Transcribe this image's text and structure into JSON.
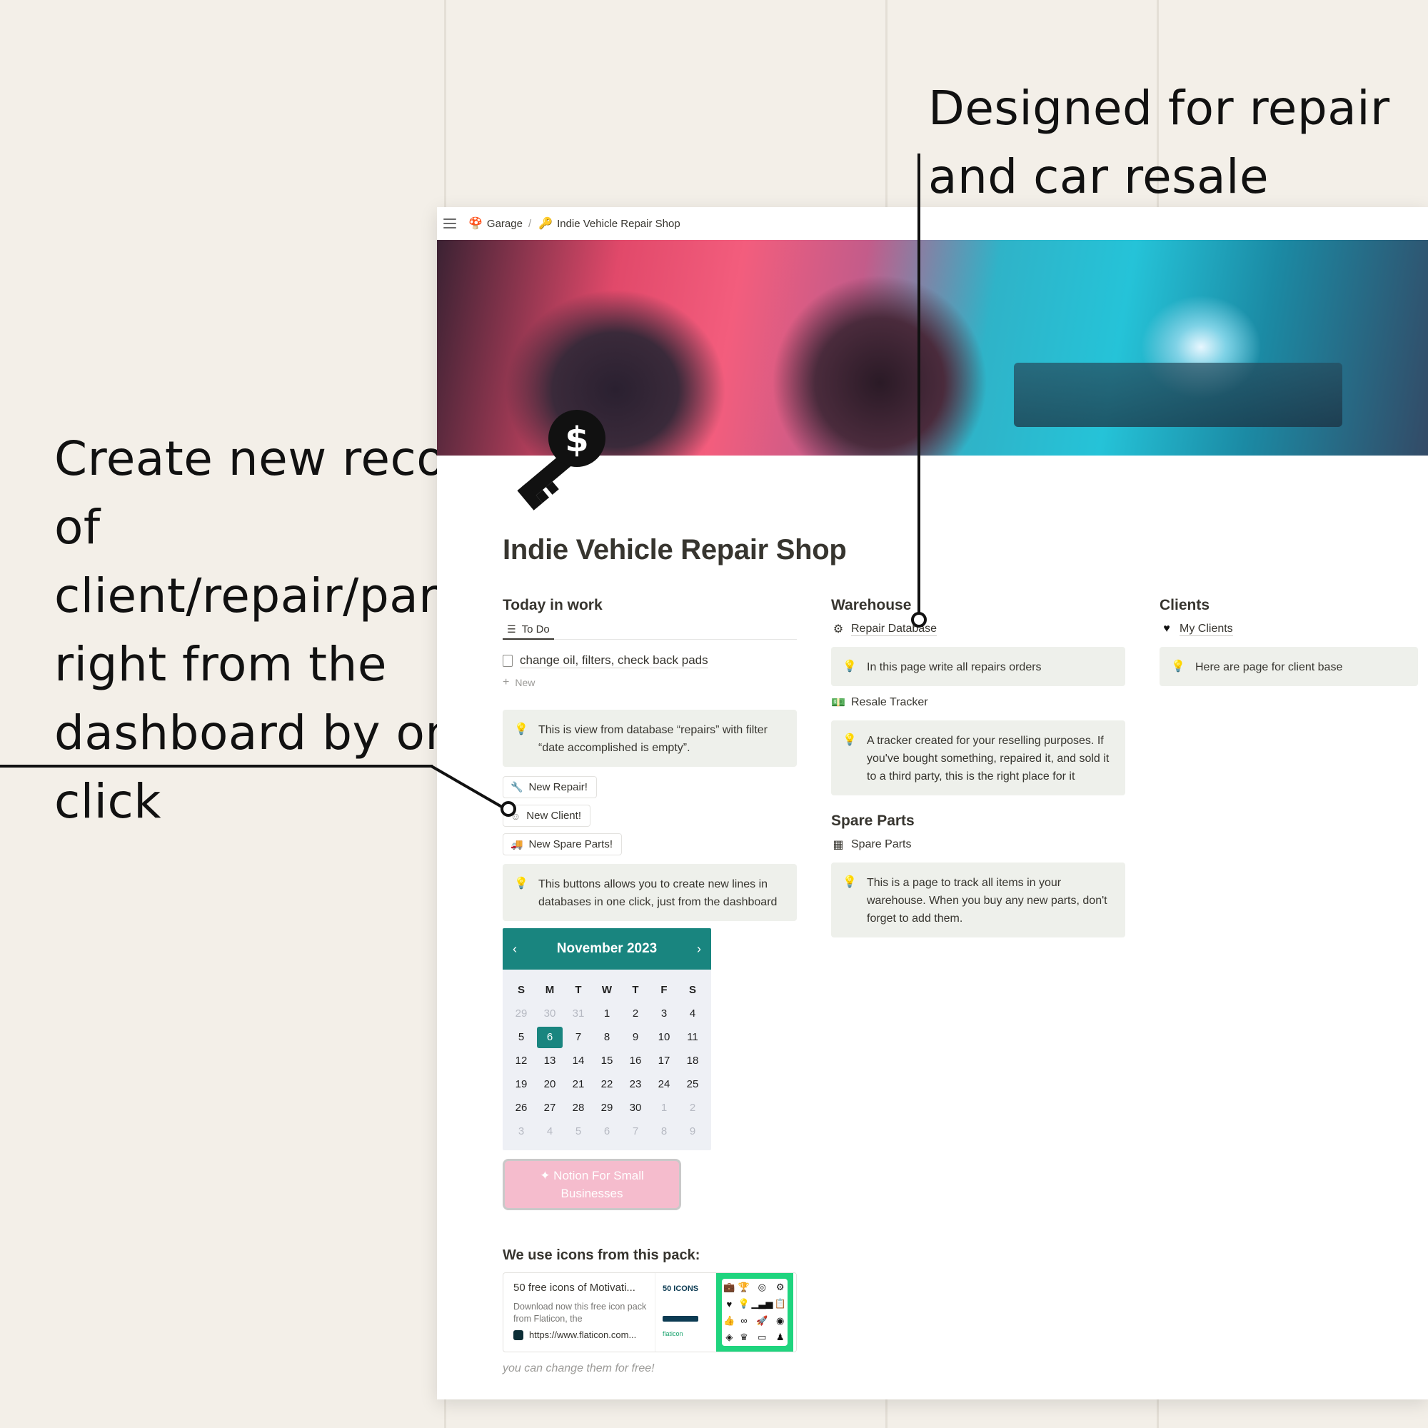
{
  "annotations": {
    "left": "Create new record of client/repair/part right from the dashboard by one click",
    "right": "Designed for repair and car resale shops."
  },
  "breadcrumb": {
    "root": {
      "icon": "mushroom-icon",
      "label": "Garage"
    },
    "separator": "/",
    "current": {
      "icon": "key-icon",
      "label": "Indie Vehicle Repair Shop"
    }
  },
  "page": {
    "title": "Indie Vehicle Repair Shop"
  },
  "today": {
    "heading": "Today in work",
    "view_tab": "To Do",
    "items": [
      "change oil, filters, check back pads"
    ],
    "new_label": "New",
    "callout": "This is view from database “repairs” with filter “date accomplished is empty”.",
    "buttons": [
      {
        "icon": "wrench-icon",
        "label": "New Repair!"
      },
      {
        "icon": "face-icon",
        "label": "New Client!"
      },
      {
        "icon": "truck-icon",
        "label": "New Spare Parts!"
      }
    ],
    "buttons_callout": "This buttons allows you to create new lines in databases in one click, just from the dashboard"
  },
  "calendar": {
    "month": "November 2023",
    "prev": "‹",
    "next": "›",
    "days_of_week": [
      "S",
      "M",
      "T",
      "W",
      "T",
      "F",
      "S"
    ],
    "weeks": [
      [
        "29",
        "30",
        "31",
        "1",
        "2",
        "3",
        "4"
      ],
      [
        "5",
        "6",
        "7",
        "8",
        "9",
        "10",
        "11"
      ],
      [
        "12",
        "13",
        "14",
        "15",
        "16",
        "17",
        "18"
      ],
      [
        "19",
        "20",
        "21",
        "22",
        "23",
        "24",
        "25"
      ],
      [
        "26",
        "27",
        "28",
        "29",
        "30",
        "1",
        "2"
      ],
      [
        "3",
        "4",
        "5",
        "6",
        "7",
        "8",
        "9"
      ]
    ],
    "today": "6",
    "accent_color": "#19857f"
  },
  "promo": {
    "line1": "Notion For Small",
    "line2": "Businesses",
    "icon": "sparkle-icon"
  },
  "icons_section": {
    "heading": "We use icons from this pack:",
    "bookmark_title": "50 free icons of Motivati...",
    "bookmark_desc": "Download now this free icon pack from Flaticon, the",
    "bookmark_url": "https://www.flaticon.com...",
    "thumb_label": "50 ICONS",
    "thumb_brand": "flaticon",
    "caption": "you can change them for free!"
  },
  "warehouse": {
    "heading": "Warehouse",
    "repair_db": {
      "icon": "gear-icon",
      "label": "Repair Database"
    },
    "repair_callout": "In this page write all repairs orders",
    "resale": {
      "icon": "money-icon",
      "label": "Resale Tracker"
    },
    "resale_callout": "A tracker created for your reselling purposes. If you've bought something, repaired it, and sold it to a third party, this is the right place for it"
  },
  "spare_parts": {
    "heading": "Spare Parts",
    "link": {
      "icon": "boxes-icon",
      "label": "Spare Parts"
    },
    "callout": "This is a page to track all items in your warehouse. When you buy any new parts, don't forget to add them."
  },
  "clients": {
    "heading": "Clients",
    "link": {
      "icon": "heart-icon",
      "label": "My Clients"
    },
    "callout": "Here are page for client base"
  }
}
